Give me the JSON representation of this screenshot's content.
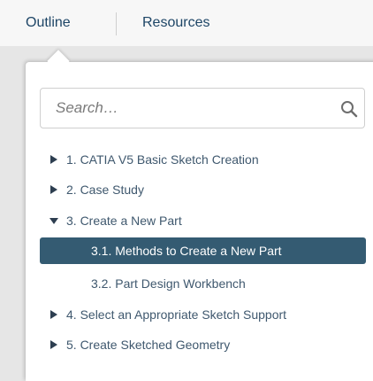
{
  "tabs": {
    "outline": "Outline",
    "resources": "Resources"
  },
  "search": {
    "placeholder": "Search…",
    "icon": "search-icon"
  },
  "toc": {
    "items": [
      {
        "label": "1. CATIA V5 Basic Sketch Creation",
        "expanded": false,
        "has_children": true
      },
      {
        "label": "2. Case Study",
        "expanded": false,
        "has_children": true
      },
      {
        "label": "3. Create a New Part",
        "expanded": true,
        "has_children": true
      },
      {
        "label": "3.1. Methods to Create a New Part",
        "selected": true,
        "has_children": false
      },
      {
        "label": "3.2. Part Design Workbench",
        "has_children": false
      },
      {
        "label": "4. Select an Appropriate Sketch Support",
        "expanded": false,
        "has_children": true
      },
      {
        "label": "5. Create Sketched Geometry",
        "expanded": false,
        "has_children": true
      }
    ]
  },
  "colors": {
    "tab_text": "#1d4566",
    "item_text": "#3f586e",
    "selected_bg": "#345b72",
    "selected_text": "#ffffff",
    "page_bg": "#e6e6e6"
  }
}
